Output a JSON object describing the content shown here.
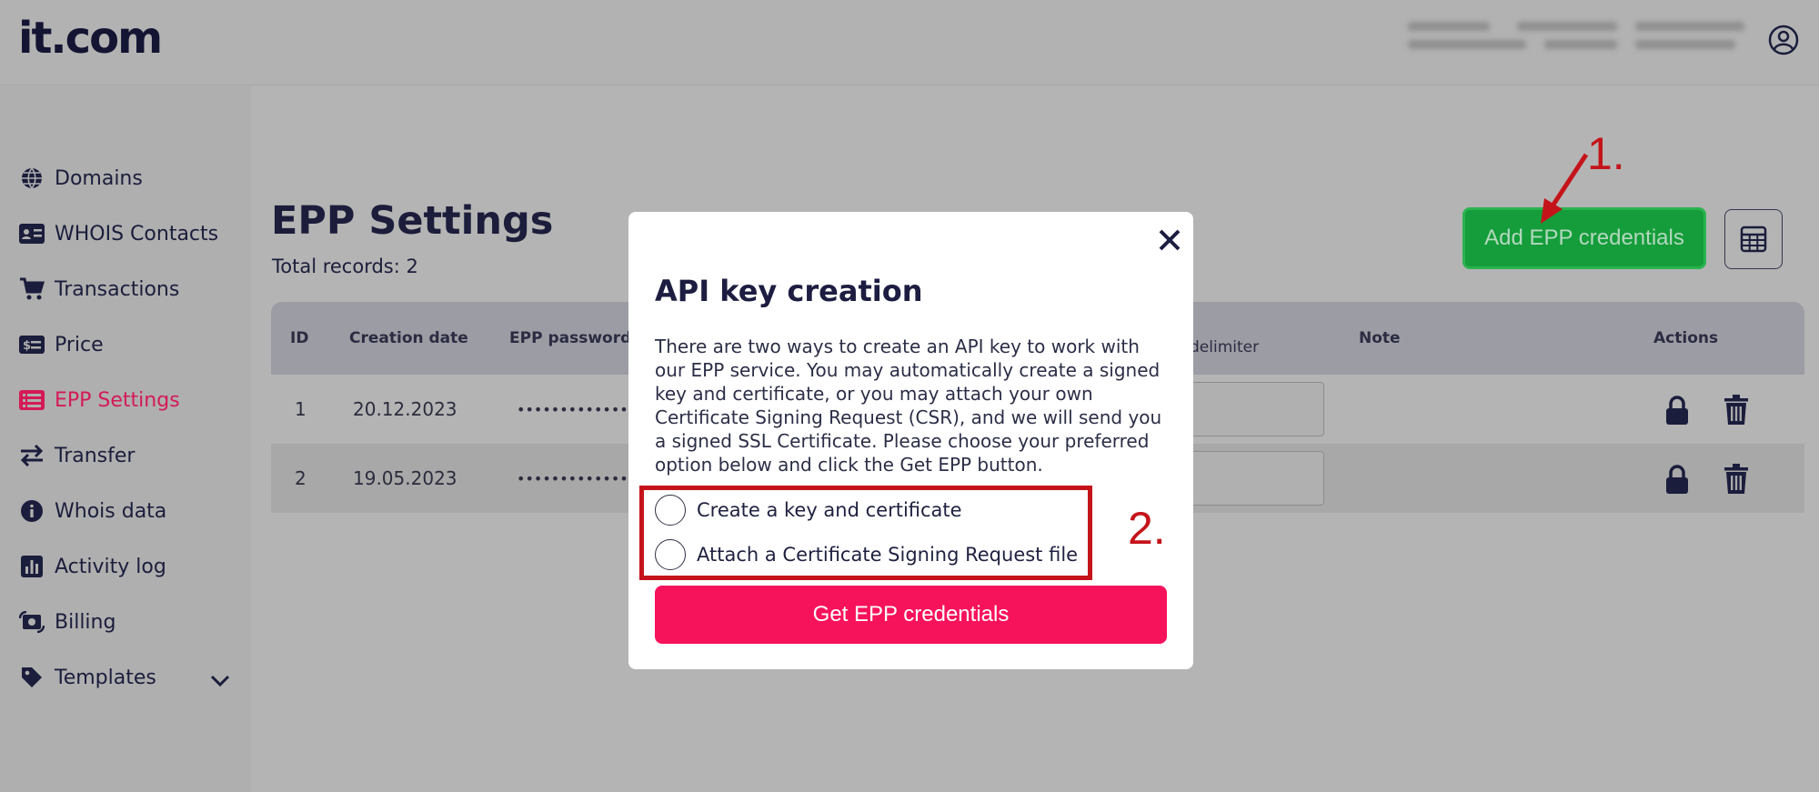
{
  "header": {
    "logo": "it.com"
  },
  "sidebar": {
    "items": [
      {
        "label": "Domains",
        "icon": "globe-icon",
        "active": false
      },
      {
        "label": "WHOIS Contacts",
        "icon": "id-card-icon",
        "active": false
      },
      {
        "label": "Transactions",
        "icon": "cart-icon",
        "active": false
      },
      {
        "label": "Price",
        "icon": "price-tag-icon",
        "active": false
      },
      {
        "label": "EPP Settings",
        "icon": "list-icon",
        "active": true
      },
      {
        "label": "Transfer",
        "icon": "transfer-arrows-icon",
        "active": false
      },
      {
        "label": "Whois data",
        "icon": "info-icon",
        "active": false
      },
      {
        "label": "Activity log",
        "icon": "bar-chart-icon",
        "active": false
      },
      {
        "label": "Billing",
        "icon": "billing-icon",
        "active": false
      },
      {
        "label": "Templates",
        "icon": "tag-icon",
        "active": false
      }
    ]
  },
  "main": {
    "title": "EPP Settings",
    "total_records": "Total records: 2",
    "add_button": "Add EPP credentials",
    "table": {
      "headers": [
        "ID",
        "Creation date",
        "EPP password(A",
        "delimiter",
        "Note",
        "Actions"
      ],
      "rows": [
        {
          "id": "1",
          "date": "20.12.2023",
          "password": "•••••••••••••••"
        },
        {
          "id": "2",
          "date": "19.05.2023",
          "password": "•••••••••••••••"
        }
      ]
    }
  },
  "annotations": {
    "step1": "1.",
    "step2": "2."
  },
  "modal": {
    "title": "API key creation",
    "description": "There are two ways to create an API key to work with our EPP service. You may automatically create a signed key and certificate, or you may attach your own Certificate Signing Request (CSR), and we will send you a signed SSL Certificate. Please choose your preferred option below and click the Get EPP button.",
    "options": [
      "Create a key and certificate",
      "Attach a Certificate Signing Request file"
    ],
    "submit": "Get EPP credentials"
  },
  "colors": {
    "brand_pink": "#f7125c",
    "active_nav": "#d41a56",
    "add_button_green": "#149d3a",
    "annotation_red": "#c4141a"
  }
}
